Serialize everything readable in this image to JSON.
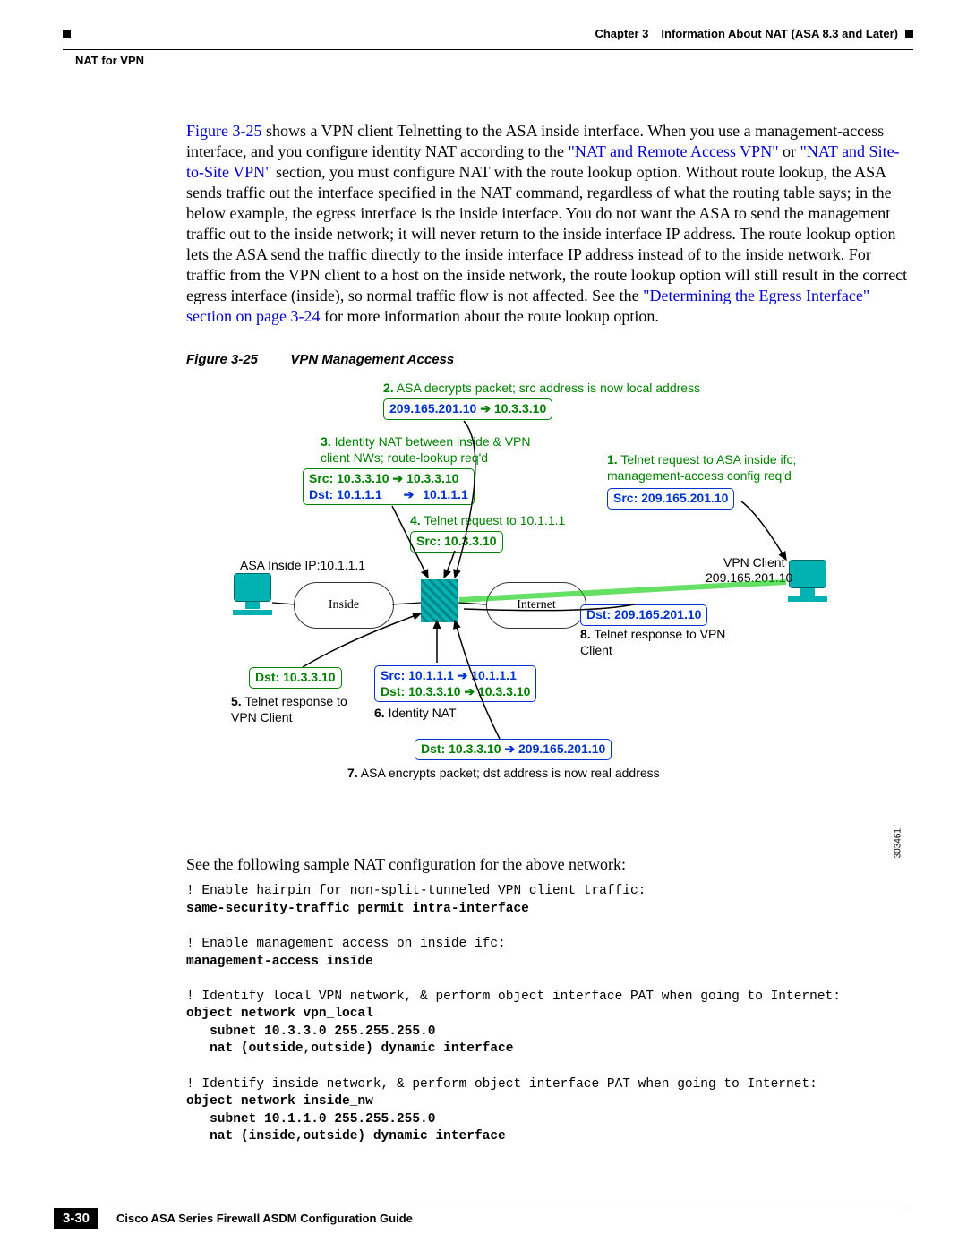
{
  "header": {
    "chapter": "Chapter 3",
    "title": "Information About NAT (ASA 8.3 and Later)",
    "section": "NAT for VPN"
  },
  "paragraph": {
    "p1a": "Figure 3-25",
    "p1b": " shows a VPN client Telnetting to the ASA inside interface. When you use a management-access interface, and you configure identity NAT according to the ",
    "p1c": "\"NAT and Remote Access VPN\"",
    "p1d": " or ",
    "p1e": "\"NAT and Site-to-Site VPN\"",
    "p1f": " section, you must configure NAT with the route lookup option. Without route lookup, the ASA sends traffic out the interface specified in the NAT command, regardless of what the routing table says; in the below example, the egress interface is the inside interface. You do not want the ASA to send the management traffic out to the inside network; it will never return to the inside interface IP address. The route lookup option lets the ASA send the traffic directly to the inside interface IP address instead of to the inside network. For traffic from the VPN client to a host on the inside network, the route lookup option will still result in the correct egress interface (inside), so normal traffic flow is not affected. See the ",
    "p1g": "\"Determining the Egress Interface\" section on page 3-24",
    "p1h": " for more information about the route lookup option."
  },
  "figure_caption": {
    "num": "Figure 3-25",
    "title": "VPN Management Access"
  },
  "figure": {
    "step2": "2.",
    "step2t": " ASA decrypts packet; src address is now local address",
    "box_a": "209.165.201.10",
    "box_a_r": "10.3.3.10",
    "step3": "3.",
    "step3t": " Identity NAT between inside & VPN client NWs; route-lookup req'd",
    "box_b_src_l": "Src: 10.3.3.10",
    "box_b_src_r": "10.3.3.10",
    "box_b_dst_l": "Dst: 10.1.1.1",
    "box_b_dst_r": "10.1.1.1",
    "step1": "1.",
    "step1t": " Telnet request to ASA inside ifc; management-access config req'd",
    "box_c": "Src: 209.165.201.10",
    "step4": "4.",
    "step4t": " Telnet request to 10.1.1.1",
    "box_d": "Src: 10.3.3.10",
    "asa_ip": "ASA Inside IP:10.1.1.1",
    "cloud_inside": "Inside",
    "cloud_internet": "Internet",
    "vpn_client": "VPN Client",
    "vpn_ip": "209.165.201.10",
    "box_e": "Dst: 209.165.201.10",
    "step8": "8.",
    "step8t": " Telnet response to VPN Client",
    "box_f": "Dst: 10.3.3.10",
    "step5": "5.",
    "step5t": " Telnet response to VPN Client",
    "box_g_src_l": "Src: 10.1.1.1",
    "box_g_src_r": "10.1.1.1",
    "box_g_dst_l": "Dst: 10.3.3.10",
    "box_g_dst_r": "10.3.3.10",
    "step6": "6.",
    "step6t": " Identity NAT",
    "box_h_l": "Dst: 10.3.3.10",
    "box_h_r": "209.165.201.10",
    "step7": "7.",
    "step7t": " ASA encrypts packet; dst address is now real address",
    "figid": "303461"
  },
  "followtext": "See the following sample NAT configuration for the above network:",
  "code": "! Enable hairpin for non-split-tunneled VPN client traffic:\nsame-security-traffic permit intra-interface\n\n! Enable management access on inside ifc:\nmanagement-access inside\n\n! Identify local VPN network, & perform object interface PAT when going to Internet:\nobject network vpn_local\n   subnet 10.3.3.0 255.255.255.0\n   nat (outside,outside) dynamic interface\n\n! Identify inside network, & perform object interface PAT when going to Internet:\nobject network inside_nw\n   subnet 10.1.1.0 255.255.255.0\n   nat (inside,outside) dynamic interface",
  "code_bold_lines": [
    1,
    4,
    7,
    8,
    9,
    12,
    13,
    14
  ],
  "footer": {
    "guide": "Cisco ASA Series Firewall ASDM Configuration Guide",
    "page": "3-30"
  }
}
